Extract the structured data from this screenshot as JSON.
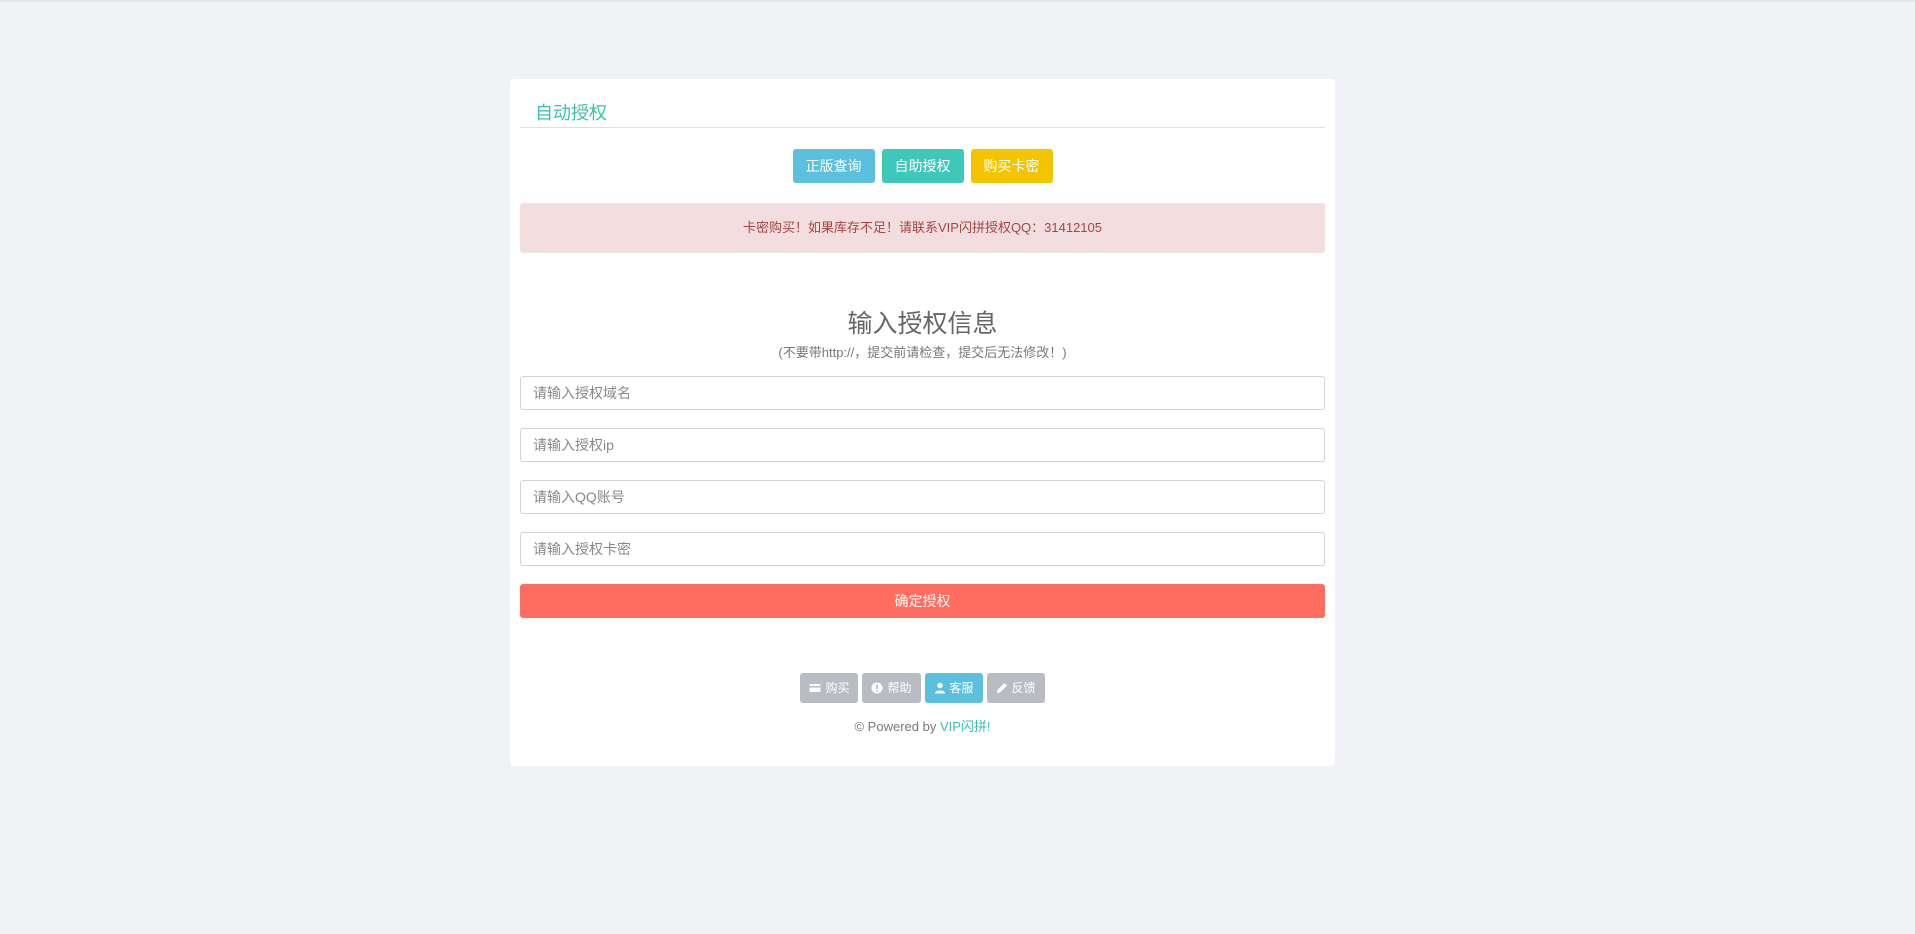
{
  "card": {
    "title": "自动授权"
  },
  "top_buttons": {
    "query": "正版查询",
    "self_auth": "自助授权",
    "buy_card": "购买卡密"
  },
  "alert": {
    "text": "卡密购买！如果库存不足！请联系VIP闪拼授权QQ：31412105"
  },
  "form": {
    "heading": "输入授权信息",
    "subheading": "(不要带http://，提交前请检查，提交后无法修改！)",
    "domain_placeholder": "请输入授权域名",
    "ip_placeholder": "请输入授权ip",
    "qq_placeholder": "请输入QQ账号",
    "card_placeholder": "请输入授权卡密",
    "submit_label": "确定授权"
  },
  "footer": {
    "buttons": [
      {
        "label": "购买",
        "icon": "credit-card-icon"
      },
      {
        "label": "帮助",
        "icon": "exclamation-circle-icon"
      },
      {
        "label": "客服",
        "icon": "user-icon"
      },
      {
        "label": "反馈",
        "icon": "pencil-icon"
      }
    ],
    "powered_prefix": "© Powered by ",
    "powered_brand": "VIP闪拼!"
  },
  "colors": {
    "page_bg": "#f0f2f6",
    "accent_teal": "#3ebfae",
    "info": "#5bc0de",
    "success": "#3ec8b9",
    "warning": "#f2c500",
    "danger": "#ff6c60",
    "alert_bg": "#f2dede",
    "alert_text": "#a94442",
    "footer_button": "#b9bdc3"
  }
}
